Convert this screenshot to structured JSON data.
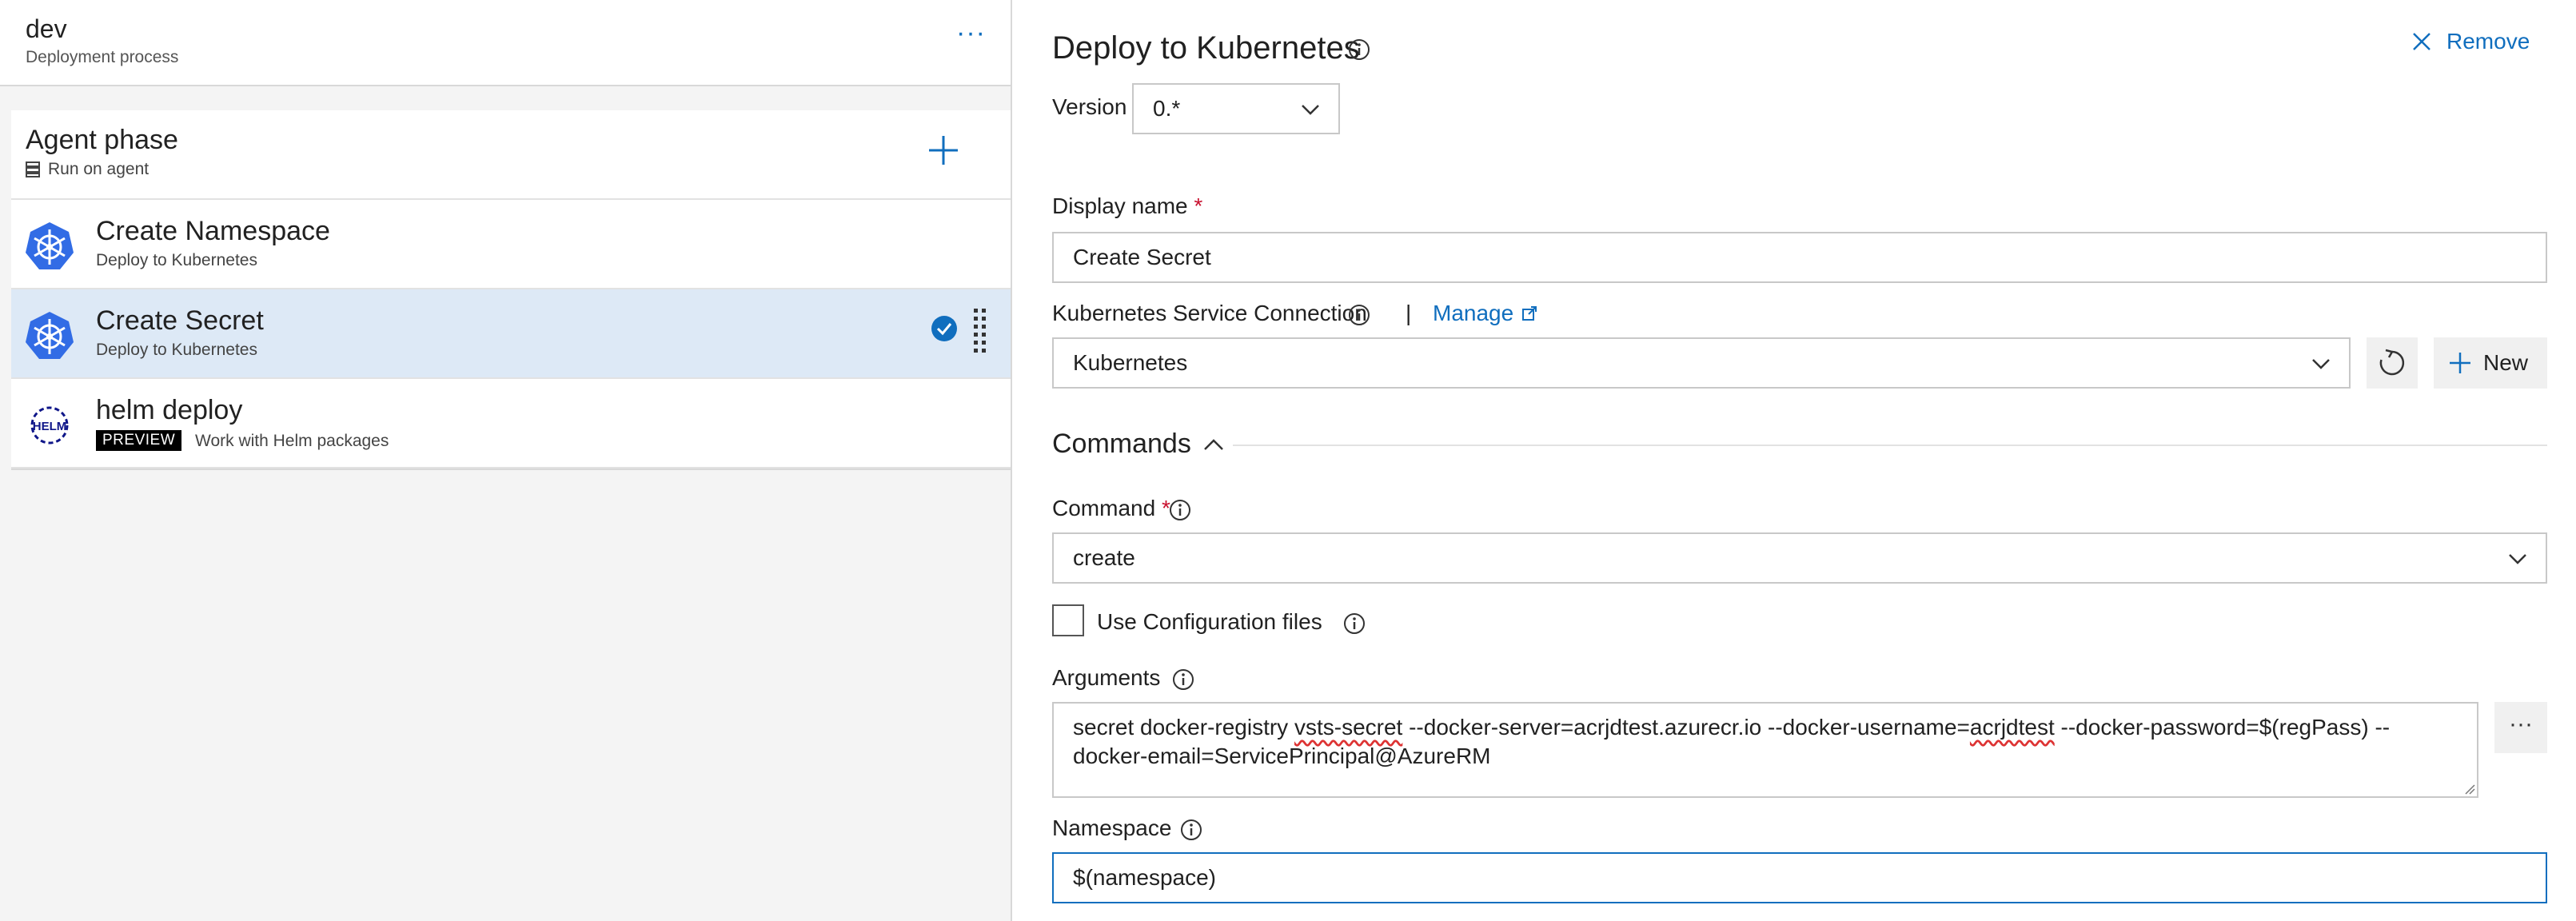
{
  "environment": {
    "name": "dev",
    "subtitle": "Deployment process",
    "more": "···"
  },
  "phase": {
    "title": "Agent phase",
    "subtitle": "Run on agent"
  },
  "tasks": [
    {
      "title": "Create Namespace",
      "subtitle": "Deploy to Kubernetes"
    },
    {
      "title": "Create Secret",
      "subtitle": "Deploy to Kubernetes"
    },
    {
      "title": "helm deploy",
      "badge": "PREVIEW",
      "subtitle": "Work with Helm packages"
    }
  ],
  "panel": {
    "title": "Deploy to Kubernetes",
    "remove_label": "Remove",
    "version_label": "Version",
    "version_value": "0.*",
    "display_name_label": "Display name",
    "display_name_value": "Create Secret",
    "ksc_label": "Kubernetes Service Connection",
    "ksc_separator": "|",
    "manage_label": "Manage",
    "ksc_value": "Kubernetes",
    "new_label": "New",
    "commands_header": "Commands",
    "command_label": "Command",
    "command_value": "create",
    "use_config_label": "Use Configuration files",
    "arguments_label": "Arguments",
    "arguments_value_pre": "secret docker-registry ",
    "arguments_value_sq1": "vsts-secret",
    "arguments_value_mid": " --docker-server=acrjdtest.azurecr.io --docker-username=",
    "arguments_value_sq2": "acrjdtest",
    "arguments_value_post": " --docker-password=$(regPass) --docker-email=ServicePrincipal@AzureRM",
    "args_more": "···",
    "namespace_label": "Namespace",
    "namespace_value": "$(namespace)",
    "required_mark": "*"
  },
  "colors": {
    "accent": "#106ebe",
    "selected_row": "#dde9f6",
    "required": "#c8102e",
    "kubernetes_blue": "#326ce5"
  }
}
